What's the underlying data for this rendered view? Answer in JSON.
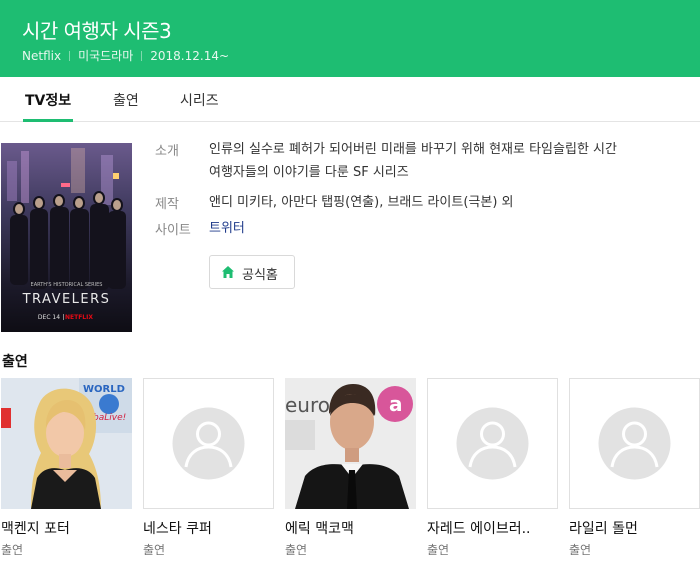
{
  "header": {
    "title": "시간 여행자 시즌3",
    "network": "Netflix",
    "genre": "미국드라마",
    "date": "2018.12.14~",
    "bg_color": "#1ebd72"
  },
  "tabs": [
    {
      "label": "TV정보",
      "active": true
    },
    {
      "label": "출연",
      "active": false
    },
    {
      "label": "시리즈",
      "active": false
    }
  ],
  "poster": {
    "title_text": "TRAVELERS",
    "tagline": "EARTH'S HISTORICAL SERIES",
    "date_text": "DEC 14",
    "brand_text": "NETFLIX"
  },
  "info": {
    "intro_label": "소개",
    "intro_line1": "인류의 실수로 폐허가 되어버린 미래를 바꾸기 위해 현재로 타임슬립한 시간",
    "intro_line2": "여행자들의 이야기를 다룬 SF 시리즈",
    "production_label": "제작",
    "production_value": "앤디 미키타, 아만다 탭핑(연출), 브래드 라이트(극본) 외",
    "site_label": "사이트",
    "site_link": "트위터",
    "home_button": "공식홈"
  },
  "cast": {
    "title": "출연",
    "members": [
      {
        "name": "맥켄지 포터",
        "role": "출연",
        "photo": "woman-photo"
      },
      {
        "name": "네스타 쿠퍼",
        "role": "출연",
        "photo": "placeholder"
      },
      {
        "name": "에릭 맥코맥",
        "role": "출연",
        "photo": "man-photo"
      },
      {
        "name": "자레드 에이브러..",
        "role": "출연",
        "photo": "placeholder"
      },
      {
        "name": "라일리 돌먼",
        "role": "출연",
        "photo": "placeholder"
      }
    ],
    "photo1_text1": "WORLD",
    "photo1_text2": "baLive!",
    "photo3_text1": "euro",
    "photo3_text2": "a"
  },
  "icons": {
    "home": "home-icon",
    "placeholder": "person-silhouette-icon"
  }
}
